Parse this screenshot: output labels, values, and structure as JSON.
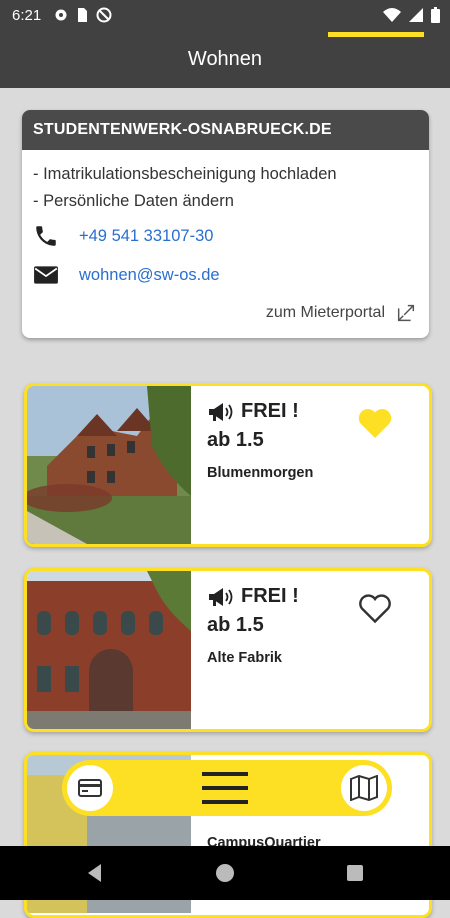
{
  "status_bar": {
    "time": "6:21"
  },
  "app_bar": {
    "title": "Wohnen"
  },
  "info_card": {
    "heading": "STUDENTENWERK-OSNABRUECK.DE",
    "lines": [
      "- Imatrikulationsbescheinigung hochladen",
      "- Persönliche Daten ändern"
    ],
    "phone": "+49 541 33107-30",
    "email": "wohnen@sw-os.de",
    "portal_link": "zum Mieterportal"
  },
  "listings": [
    {
      "status": "FREI !",
      "date": "ab 1.5",
      "name": "Blumenmorgen",
      "favorite": true
    },
    {
      "status": "FREI !",
      "date": "ab 1.5",
      "name": "Alte Fabrik",
      "favorite": false
    },
    {
      "name": "CampusQuartier"
    }
  ],
  "colors": {
    "accent": "#fddf23",
    "header": "#414141",
    "link": "#2a6fcf"
  },
  "icons": {
    "status": [
      "gear-icon",
      "sim-icon",
      "no-disturb-icon",
      "wifi-icon",
      "signal-icon",
      "battery-icon"
    ],
    "bottom": [
      "card-icon",
      "menu-icon",
      "map-icon"
    ]
  }
}
